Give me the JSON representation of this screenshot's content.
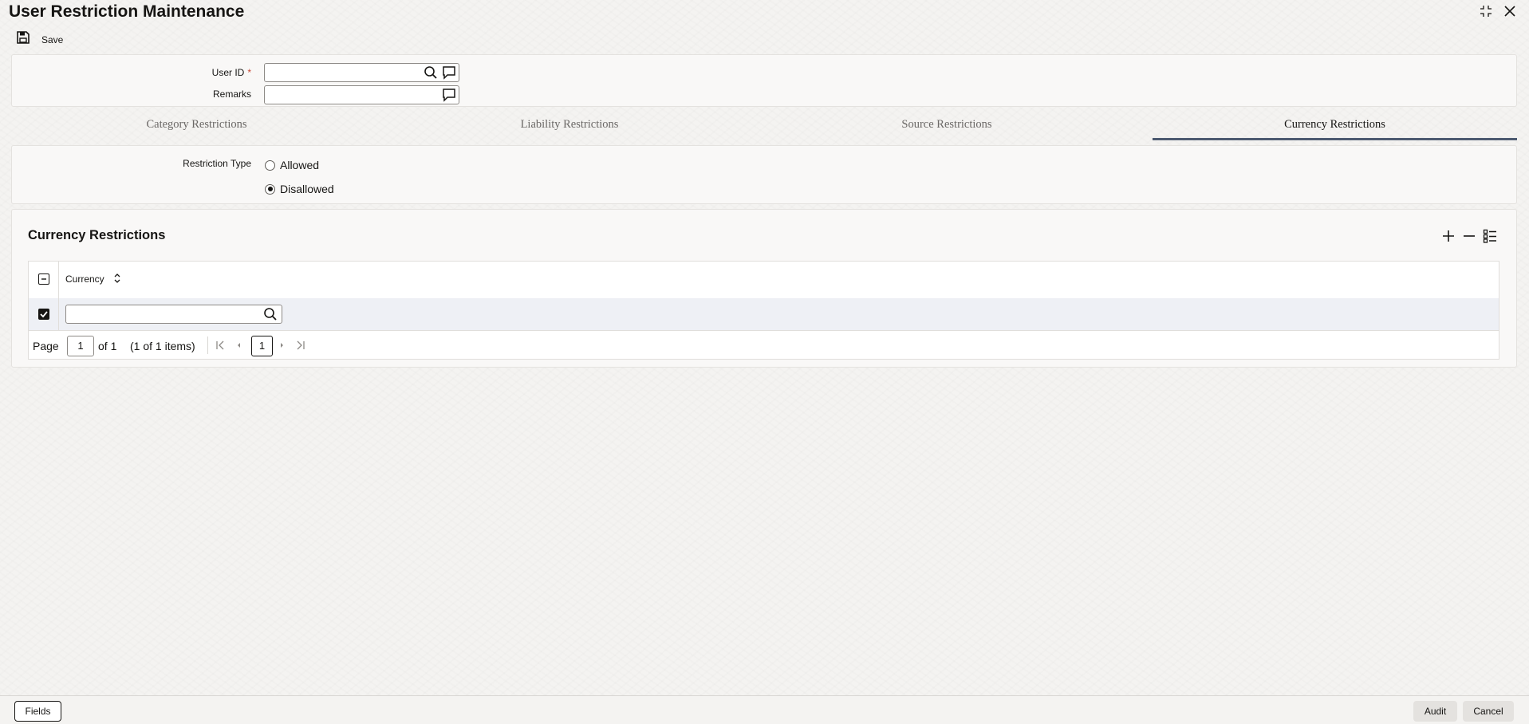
{
  "window": {
    "title": "User Restriction Maintenance"
  },
  "toolbar": {
    "save_label": "Save"
  },
  "form": {
    "user_id_label": "User ID",
    "user_id_required": "*",
    "user_id_value": "",
    "remarks_label": "Remarks",
    "remarks_value": ""
  },
  "tabs": [
    {
      "label": "Category Restrictions",
      "active": false
    },
    {
      "label": "Liability Restrictions",
      "active": false
    },
    {
      "label": "Source Restrictions",
      "active": false
    },
    {
      "label": "Currency Restrictions",
      "active": true
    }
  ],
  "restriction": {
    "label": "Restriction Type",
    "options": [
      {
        "label": "Allowed",
        "selected": false
      },
      {
        "label": "Disallowed",
        "selected": true
      }
    ]
  },
  "currency_section": {
    "title": "Currency Restrictions",
    "column_header": "Currency",
    "rows": [
      {
        "currency": "",
        "checked": true
      }
    ],
    "pager": {
      "page_label": "Page",
      "page_value": "1",
      "of_total": "of 1",
      "items_summary": "(1 of 1 items)",
      "current_page": "1"
    }
  },
  "footer": {
    "fields_label": "Fields",
    "audit_label": "Audit",
    "cancel_label": "Cancel"
  },
  "colors": {
    "accent_tab": "#4c5a70",
    "required": "#c74634",
    "row_selected": "#eef0f5"
  }
}
